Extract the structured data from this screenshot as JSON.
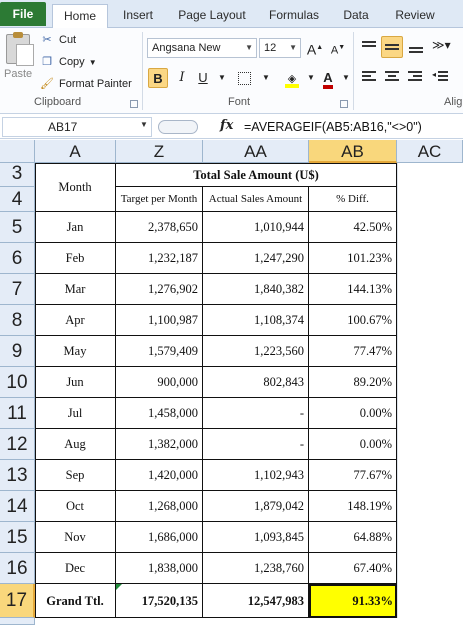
{
  "tabs": [
    "File",
    "Home",
    "Insert",
    "Page Layout",
    "Formulas",
    "Data",
    "Review"
  ],
  "ribbon": {
    "clipboard": {
      "paste_label": "Paste",
      "cut_label": "Cut",
      "copy_label": "Copy",
      "format_painter_label": "Format Painter",
      "group_label": "Clipboard"
    },
    "font": {
      "font_name": "Angsana New",
      "font_size": "12",
      "grow_label": "A",
      "shrink_label": "A",
      "bold_label": "B",
      "italic_label": "I",
      "underline_label": "U",
      "group_label": "Font"
    },
    "alignment": {
      "group_label": "Alig"
    }
  },
  "formula_bar": {
    "name_box": "AB17",
    "fx_label": "fx",
    "formula": "=AVERAGEIF(AB5:AB16,\"<>0\")"
  },
  "columns": [
    "A",
    "Z",
    "AA",
    "AB",
    "AC"
  ],
  "selected_column": "AB",
  "row_numbers": [
    "3",
    "4",
    "5",
    "6",
    "7",
    "8",
    "9",
    "10",
    "11",
    "12",
    "13",
    "14",
    "15",
    "16",
    "17"
  ],
  "selected_row": "17",
  "table": {
    "month_header": "Month",
    "group_header": "Total Sale Amount (U$)",
    "sub_headers": [
      "Target per Month",
      "Actual Sales Amount",
      "% Diff."
    ],
    "rows": [
      {
        "month": "Jan",
        "target": "2,378,650",
        "actual": "1,010,944",
        "diff": "42.50%"
      },
      {
        "month": "Feb",
        "target": "1,232,187",
        "actual": "1,247,290",
        "diff": "101.23%"
      },
      {
        "month": "Mar",
        "target": "1,276,902",
        "actual": "1,840,382",
        "diff": "144.13%"
      },
      {
        "month": "Apr",
        "target": "1,100,987",
        "actual": "1,108,374",
        "diff": "100.67%"
      },
      {
        "month": "May",
        "target": "1,579,409",
        "actual": "1,223,560",
        "diff": "77.47%"
      },
      {
        "month": "Jun",
        "target": "900,000",
        "actual": "802,843",
        "diff": "89.20%"
      },
      {
        "month": "Jul",
        "target": "1,458,000",
        "actual": "-",
        "diff": "0.00%"
      },
      {
        "month": "Aug",
        "target": "1,382,000",
        "actual": "-",
        "diff": "0.00%"
      },
      {
        "month": "Sep",
        "target": "1,420,000",
        "actual": "1,102,943",
        "diff": "77.67%"
      },
      {
        "month": "Oct",
        "target": "1,268,000",
        "actual": "1,879,042",
        "diff": "148.19%"
      },
      {
        "month": "Nov",
        "target": "1,686,000",
        "actual": "1,093,845",
        "diff": "64.88%"
      },
      {
        "month": "Dec",
        "target": "1,838,000",
        "actual": "1,238,760",
        "diff": "67.40%"
      }
    ],
    "total": {
      "label": "Grand Ttl.",
      "target": "17,520,135",
      "actual": "12,547,983",
      "diff": "91.33%"
    }
  },
  "colors": {
    "file_tab": "#2c7a34",
    "selected_header": "#f9d77c",
    "selected_cell": "#ffff00",
    "header_bg": "#e4ecf7"
  }
}
